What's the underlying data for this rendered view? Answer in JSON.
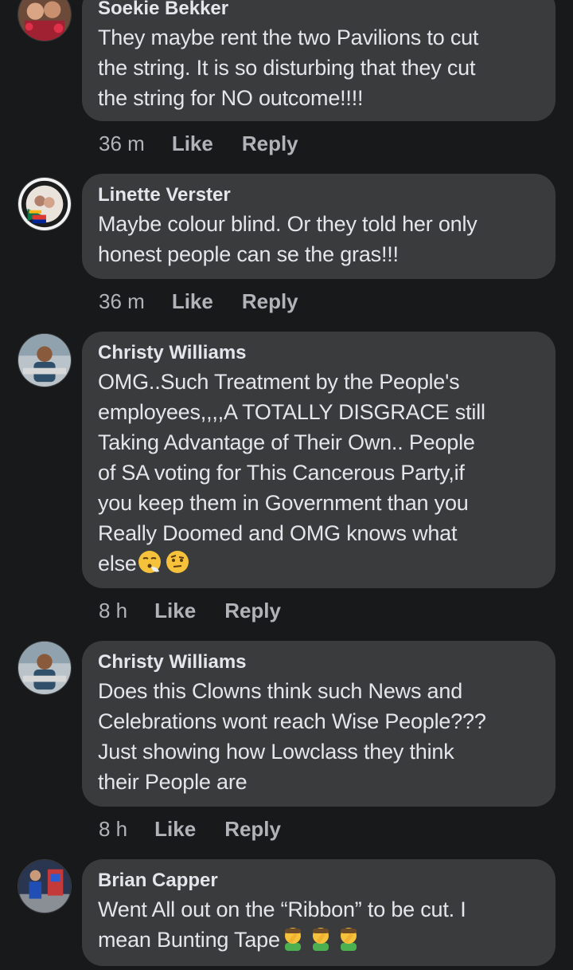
{
  "comments": [
    {
      "author": "Soekie Bekker",
      "text": "They maybe rent the two Pavilions to cut\nthe string. It is so disturbing that they cut\nthe string for NO outcome!!!!",
      "time": "36 m",
      "like_label": "Like",
      "reply_label": "Reply"
    },
    {
      "author": "Linette Verster",
      "text": "Maybe colour blind. Or they told her only\nhonest people can se the gras!!!",
      "time": "36 m",
      "like_label": "Like",
      "reply_label": "Reply"
    },
    {
      "author": "Christy Williams",
      "text": "OMG..Such Treatment by the People's\nemployees,,,,A TOTALLY DISGRACE still\nTaking Advantage of Their Own.. People\nof SA voting for This Cancerous Party,if\nyou keep them in Government than you\nReally Doomed and OMG knows what",
      "text_last": "else",
      "emojis": [
        "face-exhaling-emoji",
        "face-with-raised-eyebrow-emoji"
      ],
      "time": "8 h",
      "like_label": "Like",
      "reply_label": "Reply"
    },
    {
      "author": "Christy Williams",
      "text": "Does this Clowns think such News and\nCelebrations wont reach Wise People???\nJust showing how Lowclass they think\ntheir People are",
      "time": "8 h",
      "like_label": "Like",
      "reply_label": "Reply"
    },
    {
      "author": "Brian Capper",
      "text": "Went All out on the “Ribbon” to be cut. I",
      "text_last": "mean Bunting Tape",
      "emojis": [
        "man-facepalming-emoji",
        "man-facepalming-emoji",
        "man-facepalming-emoji"
      ]
    }
  ]
}
